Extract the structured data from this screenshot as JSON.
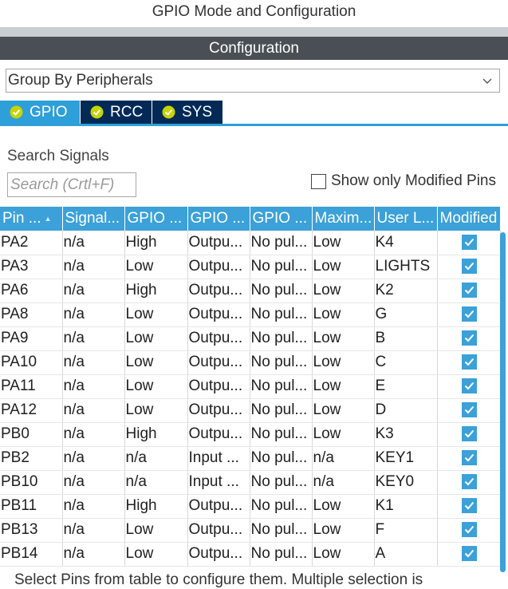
{
  "window": {
    "title": "GPIO Mode and Configuration"
  },
  "configuration_bar": {
    "label": "Configuration"
  },
  "group_by": {
    "selected": "Group By Peripherals"
  },
  "tabs": [
    {
      "label": "GPIO",
      "active": true
    },
    {
      "label": "RCC",
      "active": false
    },
    {
      "label": "SYS",
      "active": false
    }
  ],
  "search": {
    "label": "Search Signals",
    "placeholder": "Search (Crtl+F)"
  },
  "show_modified": {
    "label": "Show only Modified Pins",
    "checked": false
  },
  "table": {
    "headers": [
      "Pin ...",
      "Signal...",
      "GPIO ...",
      "GPIO ...",
      "GPIO ...",
      "Maxim...",
      "User L...",
      "Modified"
    ],
    "rows": [
      {
        "pin": "PA2",
        "signal": "n/a",
        "output_level": "High",
        "mode": "Outpu...",
        "pull": "No pul...",
        "speed": "Low",
        "label": "K4",
        "modified": true
      },
      {
        "pin": "PA3",
        "signal": "n/a",
        "output_level": "Low",
        "mode": "Outpu...",
        "pull": "No pul...",
        "speed": "Low",
        "label": "LIGHTS",
        "modified": true
      },
      {
        "pin": "PA6",
        "signal": "n/a",
        "output_level": "High",
        "mode": "Outpu...",
        "pull": "No pul...",
        "speed": "Low",
        "label": "K2",
        "modified": true
      },
      {
        "pin": "PA8",
        "signal": "n/a",
        "output_level": "Low",
        "mode": "Outpu...",
        "pull": "No pul...",
        "speed": "Low",
        "label": "G",
        "modified": true
      },
      {
        "pin": "PA9",
        "signal": "n/a",
        "output_level": "Low",
        "mode": "Outpu...",
        "pull": "No pul...",
        "speed": "Low",
        "label": "B",
        "modified": true
      },
      {
        "pin": "PA10",
        "signal": "n/a",
        "output_level": "Low",
        "mode": "Outpu...",
        "pull": "No pul...",
        "speed": "Low",
        "label": "C",
        "modified": true
      },
      {
        "pin": "PA11",
        "signal": "n/a",
        "output_level": "Low",
        "mode": "Outpu...",
        "pull": "No pul...",
        "speed": "Low",
        "label": "E",
        "modified": true
      },
      {
        "pin": "PA12",
        "signal": "n/a",
        "output_level": "Low",
        "mode": "Outpu...",
        "pull": "No pul...",
        "speed": "Low",
        "label": "D",
        "modified": true
      },
      {
        "pin": "PB0",
        "signal": "n/a",
        "output_level": "High",
        "mode": "Outpu...",
        "pull": "No pul...",
        "speed": "Low",
        "label": "K3",
        "modified": true
      },
      {
        "pin": "PB2",
        "signal": "n/a",
        "output_level": "n/a",
        "mode": "Input ...",
        "pull": "No pul...",
        "speed": "n/a",
        "label": "KEY1",
        "modified": true
      },
      {
        "pin": "PB10",
        "signal": "n/a",
        "output_level": "n/a",
        "mode": "Input ...",
        "pull": "No pul...",
        "speed": "n/a",
        "label": "KEY0",
        "modified": true
      },
      {
        "pin": "PB11",
        "signal": "n/a",
        "output_level": "High",
        "mode": "Outpu...",
        "pull": "No pul...",
        "speed": "Low",
        "label": "K1",
        "modified": true
      },
      {
        "pin": "PB13",
        "signal": "n/a",
        "output_level": "Low",
        "mode": "Outpu...",
        "pull": "No pul...",
        "speed": "Low",
        "label": "F",
        "modified": true
      },
      {
        "pin": "PB14",
        "signal": "n/a",
        "output_level": "Low",
        "mode": "Outpu...",
        "pull": "No pul...",
        "speed": "Low",
        "label": "A",
        "modified": true
      }
    ]
  },
  "footer_hint": "Select Pins from table to configure them. Multiple selection is",
  "colors": {
    "accent": "#3ba1d8",
    "tab_inactive": "#032a57",
    "config_bar": "#4a4f55",
    "check": "#c8d400"
  },
  "icons": {
    "tab_status": "check-circle-icon",
    "dropdown": "chevron-down-icon",
    "modified": "checkbox-checked-icon"
  }
}
